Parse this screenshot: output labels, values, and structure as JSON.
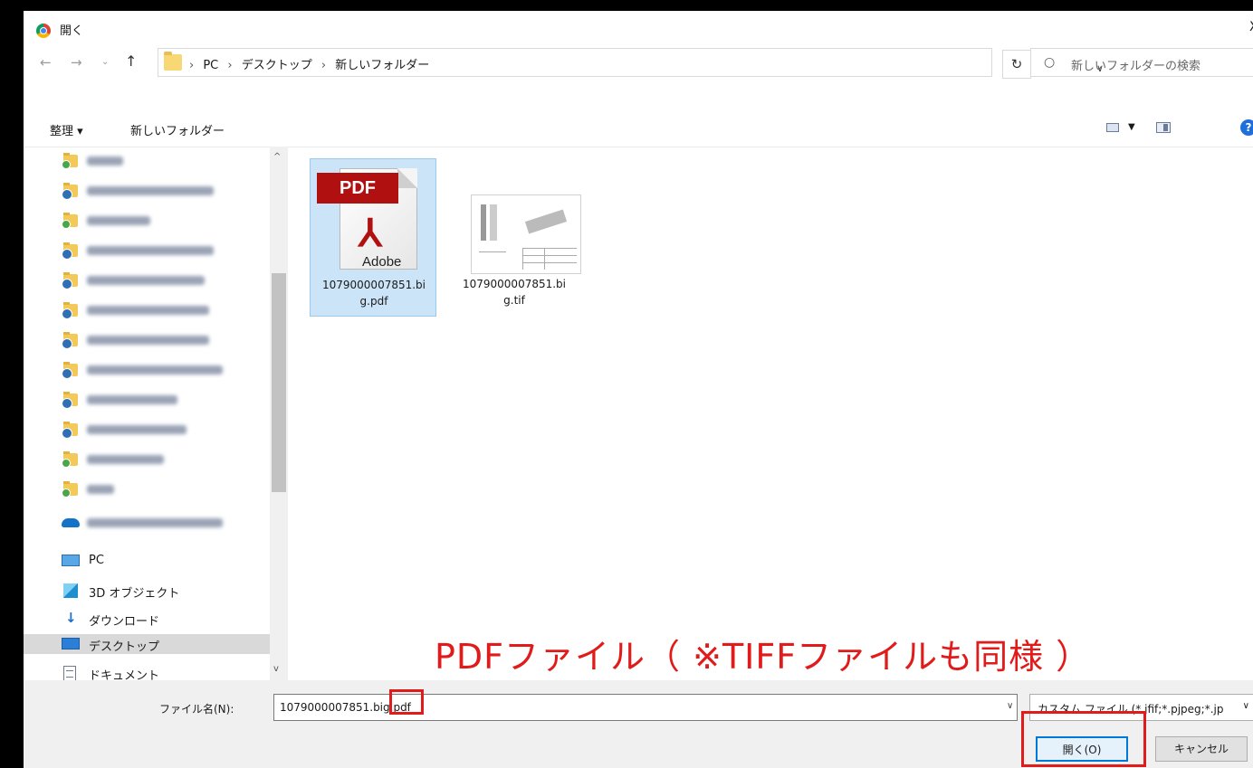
{
  "window": {
    "title": "開く",
    "close_glyph": "X"
  },
  "address": {
    "crumbs": [
      "PC",
      "デスクトップ",
      "新しいフォルダー"
    ],
    "separator": "›",
    "search_placeholder": "新しいフォルダーの検索"
  },
  "toolbar": {
    "organize_label": "整理 ▾",
    "new_folder_label": "新しいフォルダー"
  },
  "sidebar": {
    "onedrive_hidden": true,
    "pc_label": "PC",
    "items": [
      {
        "label": "3D オブジェクト",
        "icon": "3d-objects-icon"
      },
      {
        "label": "ダウンロード",
        "icon": "download-icon"
      },
      {
        "label": "デスクトップ",
        "icon": "desktop-icon",
        "selected": true
      },
      {
        "label": "ドキュメント",
        "icon": "documents-icon"
      }
    ]
  },
  "files": [
    {
      "name_line1": "1079000007851.bi",
      "name_line2": "g.pdf",
      "type": "pdf",
      "selected": true,
      "badge": "PDF",
      "brand": "Adobe"
    },
    {
      "name_line1": "1079000007851.bi",
      "name_line2": "g.tif",
      "type": "tif",
      "selected": false
    }
  ],
  "bottom": {
    "filename_label": "ファイル名(N):",
    "filename_value": "1079000007851.big.pdf",
    "filetype_value": "カスタム ファイル (*.jfif;*.pjpeg;*.jp",
    "open_label": "開く(O)",
    "cancel_label": "キャンセル"
  },
  "annotation": {
    "callout": "PDFファイル（ ※TIFFファイルも同様 ）",
    "color": "#e11a1a"
  }
}
